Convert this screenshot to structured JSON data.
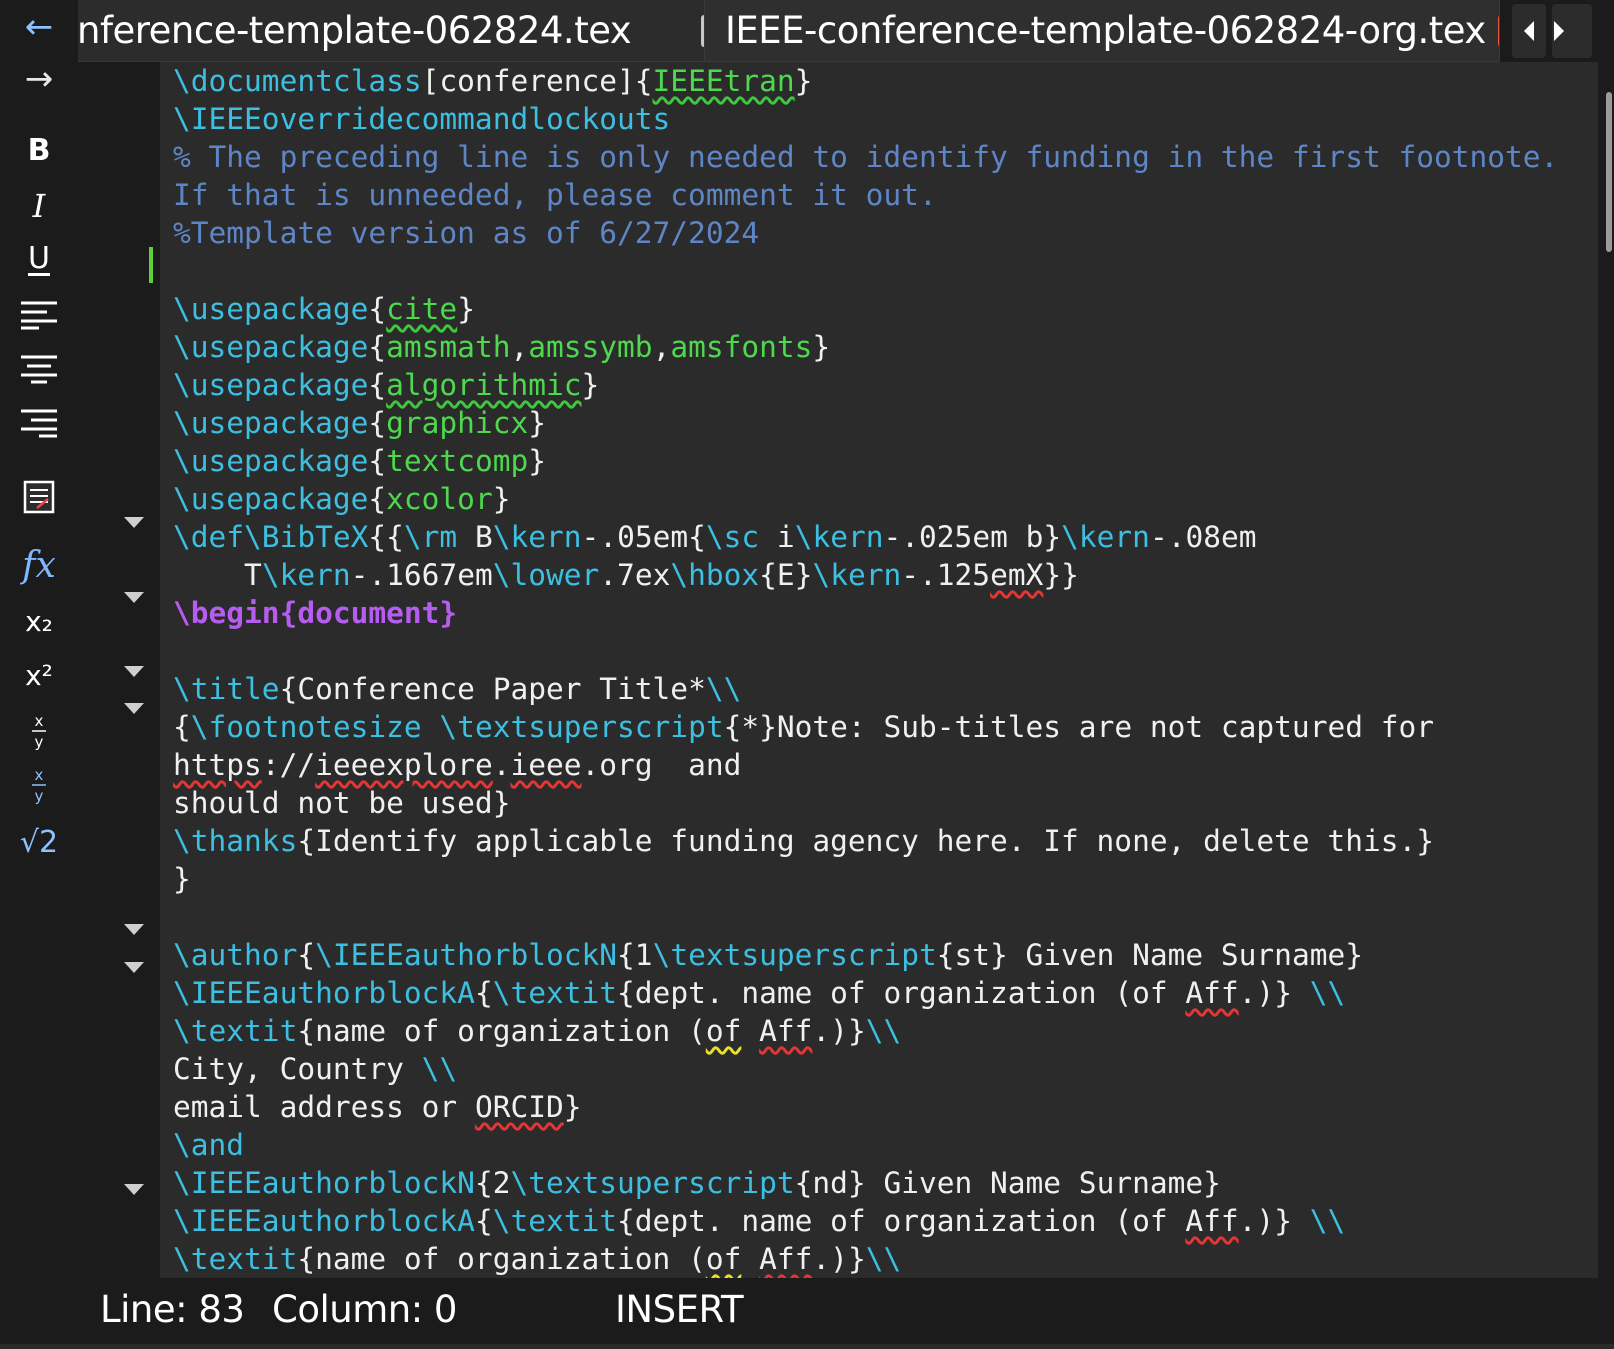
{
  "tabs": [
    {
      "label": "nference-template-062824.tex",
      "active": false
    },
    {
      "label": "IEEE-conference-template-062824-org.tex",
      "active": true
    }
  ],
  "toolbar": {
    "back_glyph": "←",
    "forward_glyph": "→",
    "bold_glyph": "B",
    "italic_glyph": "I",
    "underline_glyph": "U",
    "fx_glyph": "fx",
    "subscript_glyph": "x₂",
    "superscript_glyph": "x²",
    "sqrt_glyph": "√2",
    "icons": [
      "back-arrow-icon",
      "forward-arrow-icon",
      "bold-icon",
      "italic-icon",
      "underline-icon",
      "align-left-icon",
      "align-center-icon",
      "align-right-icon",
      "document-icon",
      "function-icon",
      "subscript-icon",
      "superscript-icon",
      "fraction-icon",
      "small-fraction-icon",
      "sqrt-icon"
    ]
  },
  "editor": {
    "lines": [
      [
        [
          "k",
          "\\documentclass"
        ],
        [
          "t",
          "[conference]{"
        ],
        [
          "g",
          "IEEEtran",
          "sq-g"
        ],
        [
          "t",
          "}"
        ]
      ],
      [
        [
          "k",
          "\\IEEEoverridecommandlockouts"
        ]
      ],
      [
        [
          "c",
          "% The preceding line is only needed to identify funding in the first footnote."
        ]
      ],
      [
        [
          "c",
          "If that is unneeded, please comment it out."
        ]
      ],
      [
        [
          "c",
          "%Template version as of 6/27/2024"
        ]
      ],
      [],
      [
        [
          "k",
          "\\usepackage"
        ],
        [
          "t",
          "{"
        ],
        [
          "g",
          "cite",
          "sq-g"
        ],
        [
          "t",
          "}"
        ]
      ],
      [
        [
          "k",
          "\\usepackage"
        ],
        [
          "t",
          "{"
        ],
        [
          "g",
          "amsmath"
        ],
        [
          "t",
          ","
        ],
        [
          "g",
          "amssymb"
        ],
        [
          "t",
          ","
        ],
        [
          "g",
          "amsfonts"
        ],
        [
          "t",
          "}"
        ]
      ],
      [
        [
          "k",
          "\\usepackage"
        ],
        [
          "t",
          "{"
        ],
        [
          "g",
          "algorithmic",
          "sq-g"
        ],
        [
          "t",
          "}"
        ]
      ],
      [
        [
          "k",
          "\\usepackage"
        ],
        [
          "t",
          "{"
        ],
        [
          "g",
          "graphicx"
        ],
        [
          "t",
          "}"
        ]
      ],
      [
        [
          "k",
          "\\usepackage"
        ],
        [
          "t",
          "{"
        ],
        [
          "g",
          "textcomp"
        ],
        [
          "t",
          "}"
        ]
      ],
      [
        [
          "k",
          "\\usepackage"
        ],
        [
          "t",
          "{"
        ],
        [
          "g",
          "xcolor"
        ],
        [
          "t",
          "}"
        ]
      ],
      [
        [
          "k",
          "\\def"
        ],
        [
          "k",
          "\\BibTeX"
        ],
        [
          "t",
          "{{"
        ],
        [
          "k",
          "\\rm"
        ],
        [
          "t",
          " B"
        ],
        [
          "k",
          "\\kern"
        ],
        [
          "t",
          "-.05em{"
        ],
        [
          "k",
          "\\sc"
        ],
        [
          "t",
          " i"
        ],
        [
          "k",
          "\\kern"
        ],
        [
          "t",
          "-.025em b}"
        ],
        [
          "k",
          "\\kern"
        ],
        [
          "t",
          "-.08em"
        ]
      ],
      [
        [
          "t",
          "    T"
        ],
        [
          "k",
          "\\kern"
        ],
        [
          "t",
          "-.1667em"
        ],
        [
          "k",
          "\\lower"
        ],
        [
          "t",
          ".7ex"
        ],
        [
          "k",
          "\\hbox"
        ],
        [
          "t",
          "{E}"
        ],
        [
          "k",
          "\\kern"
        ],
        [
          "t",
          "-.125"
        ],
        [
          "t",
          "emX",
          "sq-r"
        ],
        [
          "t",
          "}}"
        ]
      ],
      [
        [
          "b",
          "\\begin{"
        ],
        [
          "b",
          "document"
        ],
        [
          "b",
          "}"
        ]
      ],
      [],
      [
        [
          "k",
          "\\title"
        ],
        [
          "t",
          "{Conference Paper Title*"
        ],
        [
          "k",
          "\\\\"
        ]
      ],
      [
        [
          "t",
          "{"
        ],
        [
          "k",
          "\\footnotesize"
        ],
        [
          "t",
          " "
        ],
        [
          "k",
          "\\textsuperscript"
        ],
        [
          "t",
          "{*}Note: Sub-titles are not captured for"
        ]
      ],
      [
        [
          "t",
          "https",
          "sq-r"
        ],
        [
          "t",
          "://"
        ],
        [
          "t",
          "ieeexplore",
          "sq-r"
        ],
        [
          "t",
          "."
        ],
        [
          "t",
          "ieee",
          "sq-r"
        ],
        [
          "t",
          ".org  and"
        ]
      ],
      [
        [
          "t",
          "should not be used}"
        ]
      ],
      [
        [
          "k",
          "\\thanks"
        ],
        [
          "t",
          "{Identify applicable funding agency here. If none, delete this.}"
        ]
      ],
      [
        [
          "t",
          "}"
        ]
      ],
      [],
      [
        [
          "k",
          "\\author"
        ],
        [
          "t",
          "{"
        ],
        [
          "k",
          "\\IEEEauthorblockN"
        ],
        [
          "t",
          "{1"
        ],
        [
          "k",
          "\\textsuperscript"
        ],
        [
          "t",
          "{st} Given Name Surname}"
        ]
      ],
      [
        [
          "k",
          "\\IEEEauthorblockA"
        ],
        [
          "t",
          "{"
        ],
        [
          "k",
          "\\textit"
        ],
        [
          "t",
          "{dept. name of organization (of "
        ],
        [
          "t",
          "Aff",
          "sq-r"
        ],
        [
          "t",
          ".)} "
        ],
        [
          "k",
          "\\\\"
        ]
      ],
      [
        [
          "k",
          "\\textit"
        ],
        [
          "t",
          "{name of organization ("
        ],
        [
          "t",
          "of",
          "sq-y"
        ],
        [
          "t",
          " "
        ],
        [
          "t",
          "Aff",
          "sq-r"
        ],
        [
          "t",
          ".)}"
        ],
        [
          "k",
          "\\\\"
        ]
      ],
      [
        [
          "t",
          "City, Country "
        ],
        [
          "k",
          "\\\\"
        ]
      ],
      [
        [
          "t",
          "email address or "
        ],
        [
          "t",
          "ORCID",
          "sq-r"
        ],
        [
          "t",
          "}"
        ]
      ],
      [
        [
          "k",
          "\\and"
        ]
      ],
      [
        [
          "k",
          "\\IEEEauthorblockN"
        ],
        [
          "t",
          "{2"
        ],
        [
          "k",
          "\\textsuperscript"
        ],
        [
          "t",
          "{nd} Given Name Surname}"
        ]
      ],
      [
        [
          "k",
          "\\IEEEauthorblockA"
        ],
        [
          "t",
          "{"
        ],
        [
          "k",
          "\\textit"
        ],
        [
          "t",
          "{dept. name of organization (of "
        ],
        [
          "t",
          "Aff",
          "sq-r"
        ],
        [
          "t",
          ".)} "
        ],
        [
          "k",
          "\\\\"
        ]
      ],
      [
        [
          "k",
          "\\textit"
        ],
        [
          "t",
          "{name of organization ("
        ],
        [
          "t",
          "of",
          "sq-y"
        ],
        [
          "t",
          " "
        ],
        [
          "t",
          "Aff",
          "sq-r"
        ],
        [
          "t",
          ".)}"
        ],
        [
          "k",
          "\\\\"
        ]
      ]
    ]
  },
  "status": {
    "line_label": "Line: 83",
    "column_label": "Column: 0",
    "mode": "INSERT"
  },
  "colors": {
    "keyword": "#3cbfe0",
    "argument": "#4dd84d",
    "comment": "#5e86c7",
    "begin": "#b75cf0",
    "text": "#f0f0f0",
    "close_active": "#e8553a",
    "close_inactive": "#c8c8c8",
    "change_marker": "#5fcf3a"
  }
}
